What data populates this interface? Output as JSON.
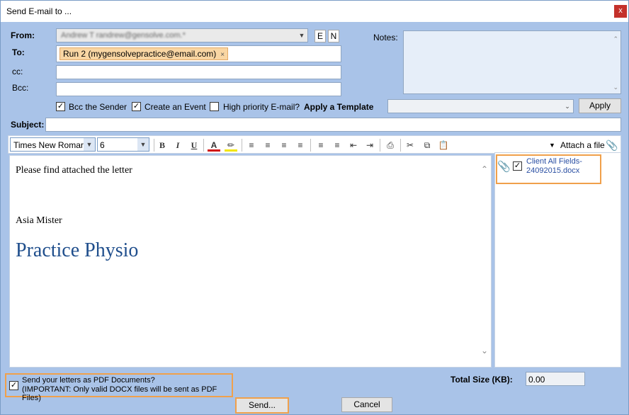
{
  "window": {
    "title": "Send E-mail to ...",
    "close_label": "x"
  },
  "from": {
    "label": "From:",
    "value": "Andrew T randrew@gensolve.com.*",
    "btn_e": "E",
    "btn_n": "N"
  },
  "to": {
    "label": "To:",
    "chip": "Run 2 (mygensolvepractice@email.com)",
    "chip_close": "×"
  },
  "cc": {
    "label": "cc:",
    "value": ""
  },
  "bcc": {
    "label": "Bcc:",
    "value": ""
  },
  "notes": {
    "label": "Notes:",
    "value": ""
  },
  "options": {
    "bcc_sender": {
      "label": "Bcc the Sender",
      "checked": true
    },
    "create_event": {
      "label": "Create an Event",
      "checked": true
    },
    "high_priority": {
      "label": "High priority E-mail?",
      "checked": false
    },
    "template_label": "Apply a Template",
    "template_value": "",
    "apply_button": "Apply"
  },
  "subject": {
    "label": "Subject:",
    "value": ""
  },
  "toolbar": {
    "font": "Times New Romar",
    "size": "6",
    "bold": "B",
    "italic": "I",
    "underline": "U",
    "attach_label": "Attach a file"
  },
  "editor": {
    "line1": "Please find attached the letter",
    "line2": "Asia Mister",
    "line3": "Practice Physio"
  },
  "attachments": [
    {
      "name": "Client All Fields-24092015.docx",
      "checked": true
    }
  ],
  "pdf_option": {
    "checked": true,
    "line1": "Send your letters as PDF Documents?",
    "line2": "(IMPORTANT: Only valid DOCX files will be sent as PDF Files)"
  },
  "total_size": {
    "label": "Total Size (KB):",
    "value": "0.00"
  },
  "buttons": {
    "send": "Send...",
    "cancel": "Cancel"
  },
  "colors": {
    "accent_highlight": "#f0a04b",
    "chip_bg": "#f9d6a3",
    "signature_blue": "#1f4e8c"
  }
}
